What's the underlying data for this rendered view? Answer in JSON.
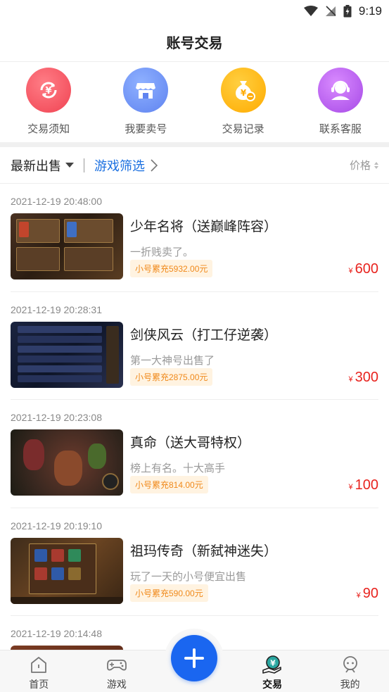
{
  "status": {
    "time": "9:19"
  },
  "header": {
    "title": "账号交易"
  },
  "quick_actions": [
    {
      "label": "交易须知",
      "icon": "refresh-yen-icon",
      "color": "#f04352"
    },
    {
      "label": "我要卖号",
      "icon": "shop-icon",
      "color": "#5f83f0"
    },
    {
      "label": "交易记录",
      "icon": "money-bag-icon",
      "color": "#ffab00"
    },
    {
      "label": "联系客服",
      "icon": "headset-icon",
      "color": "#a649e6"
    }
  ],
  "filters": {
    "latest": "最新出售",
    "game_filter": "游戏筛选",
    "price": "价格"
  },
  "listings": [
    {
      "date": "2021-12-19 20:48:00",
      "name": "少年名将（送巅峰阵容）",
      "desc": "一折贱卖了。",
      "badge": "小号累充5932.00元",
      "currency": "¥",
      "price": "600"
    },
    {
      "date": "2021-12-19 20:28:31",
      "name": "剑侠风云（打工仔逆袭）",
      "desc": "第一大神号出售了",
      "badge": "小号累充2875.00元",
      "currency": "¥",
      "price": "300"
    },
    {
      "date": "2021-12-19 20:23:08",
      "name": "真命（送大哥特权）",
      "desc": "榜上有名。十大高手",
      "badge": "小号累充814.00元",
      "currency": "¥",
      "price": "100"
    },
    {
      "date": "2021-12-19 20:19:10",
      "name": "祖玛传奇（新弑神迷失）",
      "desc": "玩了一天的小号便宜出售",
      "badge": "小号累充590.00元",
      "currency": "¥",
      "price": "90"
    },
    {
      "date": "2021-12-19 20:14:48"
    }
  ],
  "tabs": [
    {
      "label": "首页",
      "icon": "home-icon"
    },
    {
      "label": "游戏",
      "icon": "gamepad-icon"
    },
    {
      "label": "交易",
      "icon": "trade-icon",
      "active": true
    },
    {
      "label": "我的",
      "icon": "profile-icon"
    }
  ],
  "colors": {
    "accent": "#1a66f0",
    "price": "#e8231e",
    "badge_text": "#f0891a",
    "badge_bg": "#fff3e1"
  }
}
